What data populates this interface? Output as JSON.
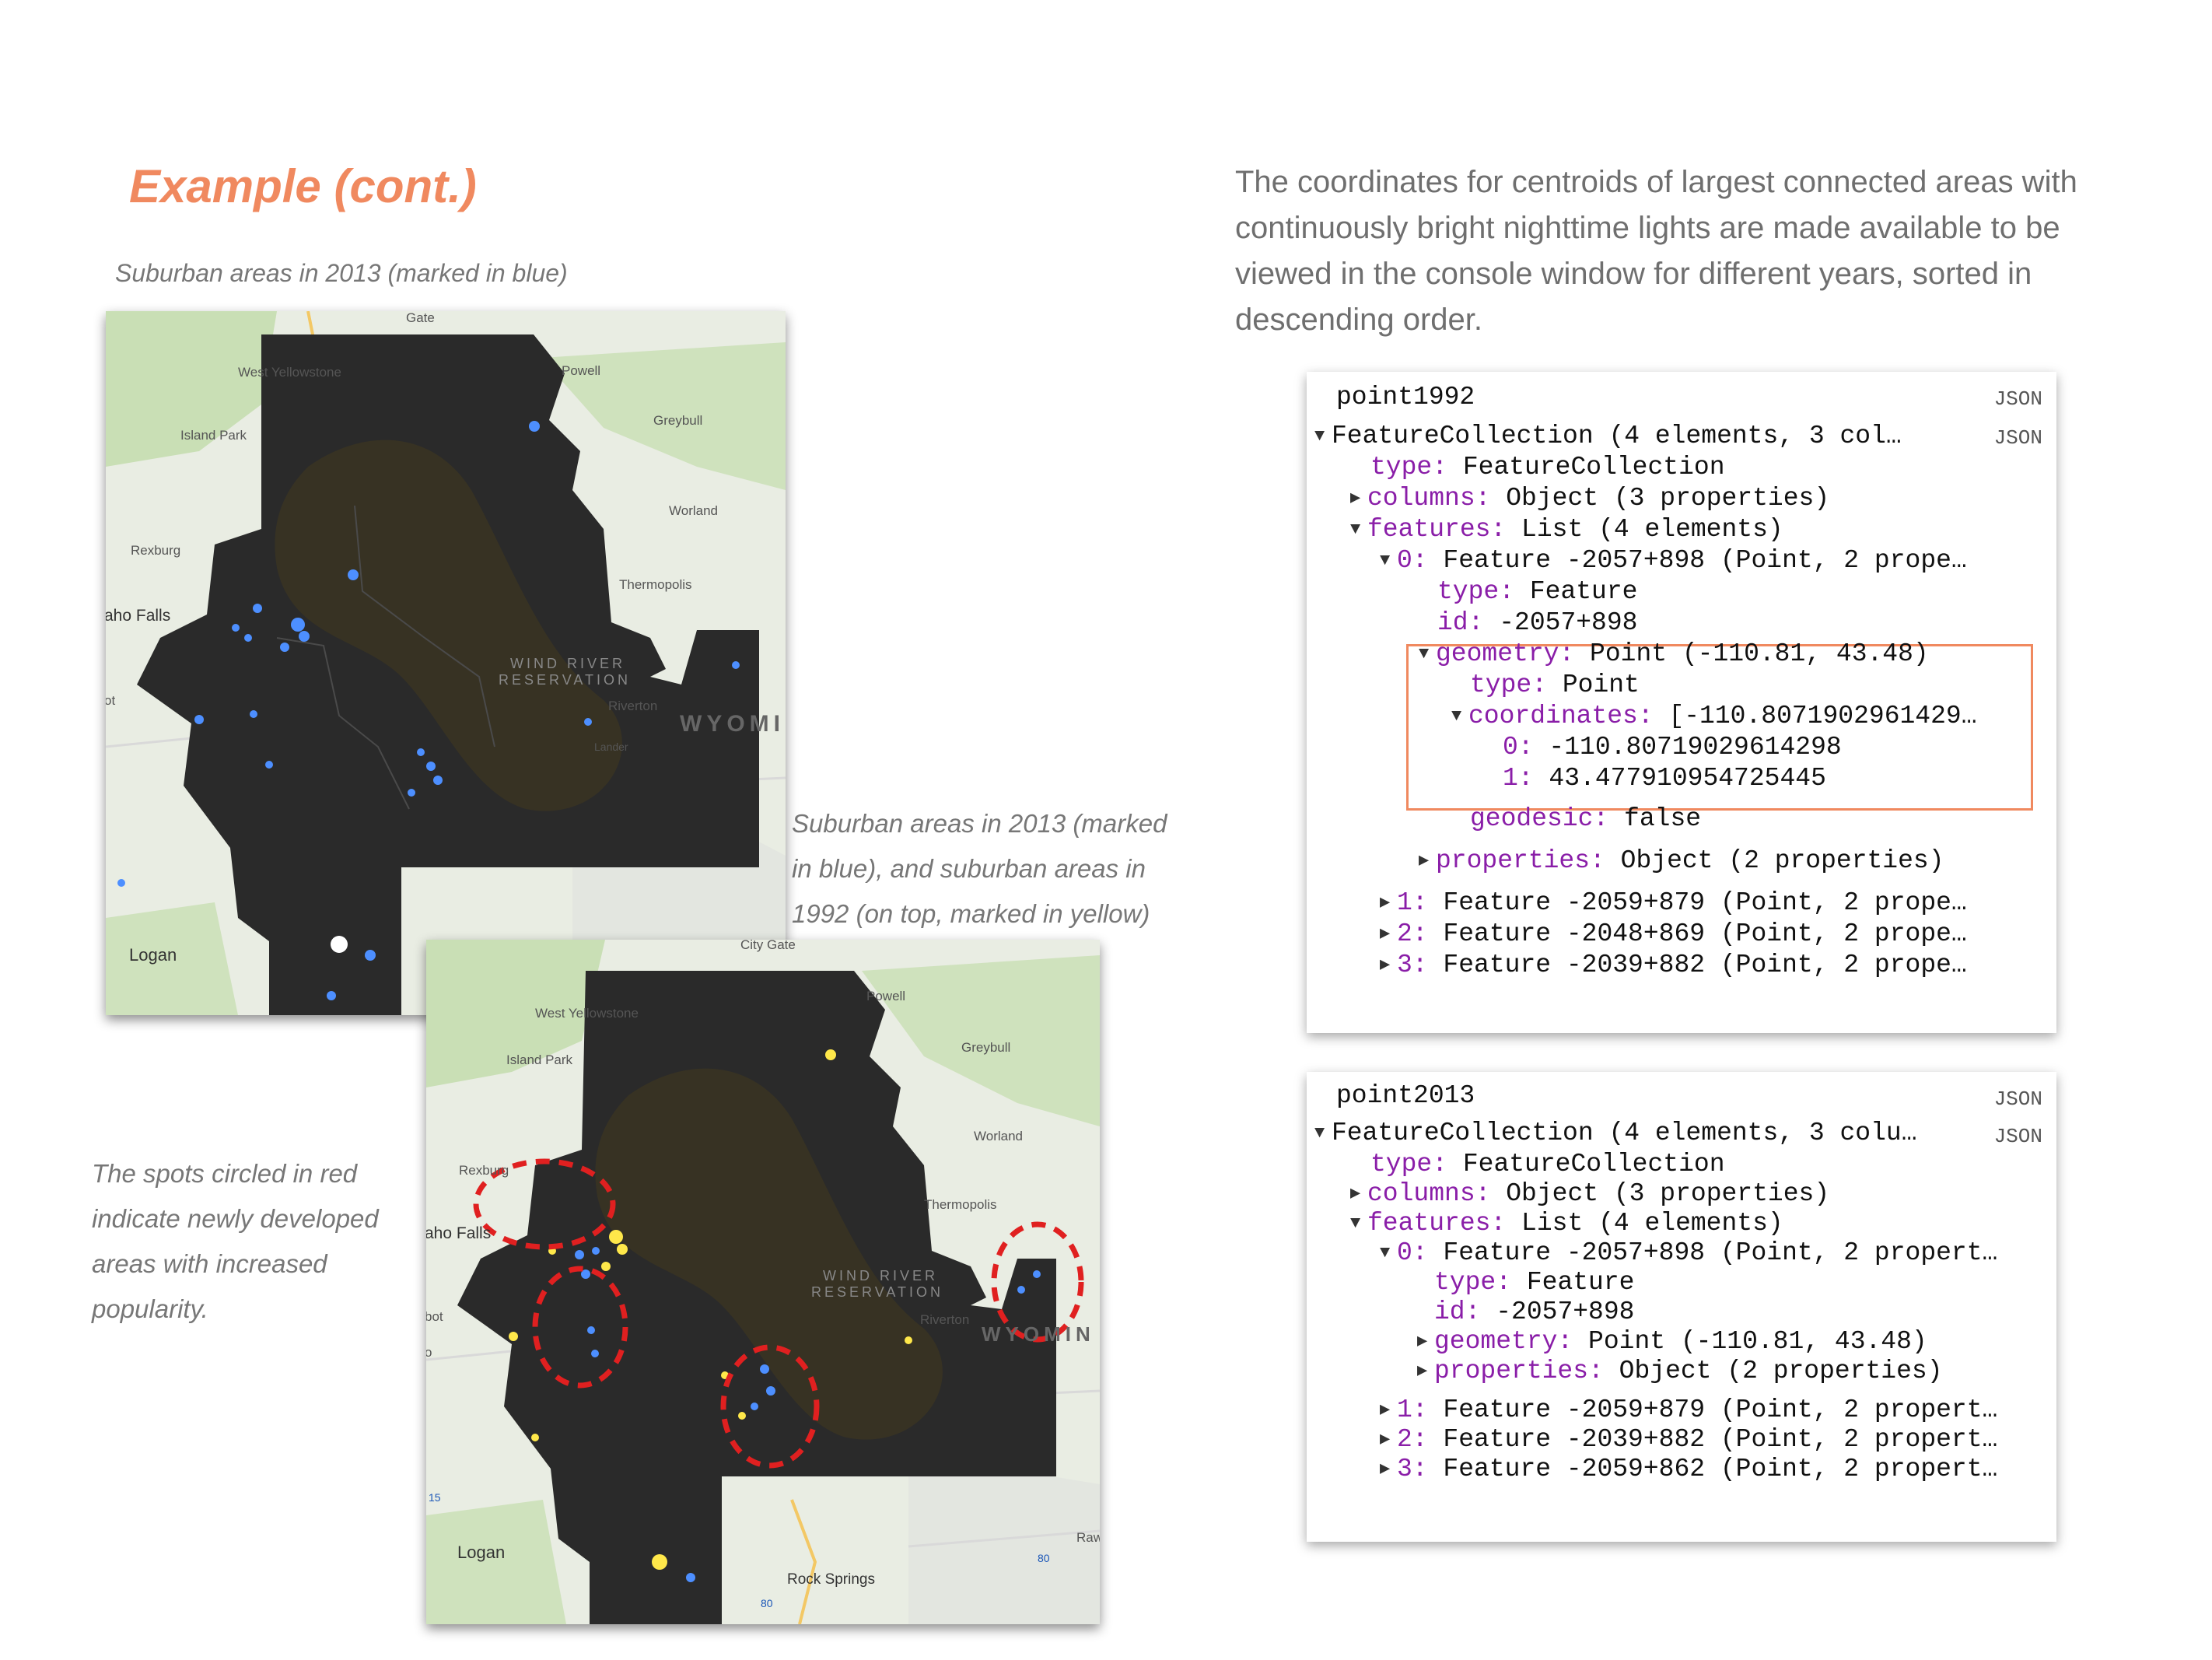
{
  "slide": {
    "title": "Example (cont.)",
    "caption_2013": "Suburban areas in 2013 (marked in blue)",
    "caption_compare_lines": [
      "Suburban areas in 2013 (marked",
      "in blue), and suburban  areas in",
      "1992 (on top, marked in yellow)"
    ],
    "caption_circles_lines": [
      "The spots circled in red",
      "indicate newly developed",
      "areas with increased",
      "popularity."
    ],
    "intro_lines": [
      "The coordinates for centroids of largest connected areas with",
      "continuously bright nighttime lights are made available to be",
      "viewed in the console window for different years, sorted in",
      "descending order."
    ]
  },
  "colors": {
    "title_orange": "#f0895f",
    "json_key_purple": "#8a1ea8",
    "highlight_box": "#f0895f",
    "circle_red": "#e02020",
    "light_blue": "#4d8fff",
    "light_yellow": "#ffe84a"
  },
  "maps": {
    "map_a": {
      "labels": [
        "Gate",
        "West Yellowstone",
        "Island Park",
        "Powell",
        "Greybull",
        "Worland",
        "Rexburg",
        "Thermopolis",
        "aho Falls",
        "WIND RIVER",
        "RESERVATION",
        "Riverton",
        "WYOMI",
        "Lander",
        "ot",
        "Logan"
      ]
    },
    "map_b": {
      "labels": [
        "City Gate",
        "Powell",
        "West Yellowstone",
        "Island Park",
        "Greybull",
        "Worland",
        "Rexburg",
        "Thermopolis",
        "aho Falls",
        "WIND RIVER",
        "RESERVATION",
        "Riverton",
        "WYOMIN",
        "bot",
        "o",
        "Logan",
        "Rock Springs",
        "Raw",
        "15",
        "80",
        "80"
      ]
    }
  },
  "console_1992": {
    "name": "point1992",
    "json_tag": "JSON",
    "collection": "FeatureCollection (4 elements, 3 col…",
    "collection_tag": "JSON",
    "type_key": "type:",
    "type_val": "FeatureCollection",
    "columns_key": "columns:",
    "columns_val": "Object (3 properties)",
    "features_key": "features:",
    "features_val": "List (4 elements)",
    "f0_key": "0:",
    "f0_val": "Feature -2057+898 (Point, 2 prope…",
    "f0_type_key": "type:",
    "f0_type_val": "Feature",
    "f0_id_key": "id:",
    "f0_id_val": "-2057+898",
    "geom_key": "geometry:",
    "geom_val": "Point (-110.81, 43.48)",
    "gtype_key": "type:",
    "gtype_val": "Point",
    "coords_key": "coordinates:",
    "coords_val": "[-110.8071902961429…",
    "c0_key": "0:",
    "c0_val": "-110.80719029614298",
    "c1_key": "1:",
    "c1_val": "43.477910954725445",
    "geodesic_key": "geodesic:",
    "geodesic_val": "false",
    "props_key": "properties:",
    "props_val": "Object (2 properties)",
    "f1_key": "1:",
    "f1_val": "Feature -2059+879 (Point, 2 prope…",
    "f2_key": "2:",
    "f2_val": "Feature -2048+869 (Point, 2 prope…",
    "f3_key": "3:",
    "f3_val": "Feature -2039+882 (Point, 2 prope…"
  },
  "console_2013": {
    "name": "point2013",
    "json_tag": "JSON",
    "collection": "FeatureCollection (4 elements, 3 colu…",
    "collection_tag": "JSON",
    "type_key": "type:",
    "type_val": "FeatureCollection",
    "columns_key": "columns:",
    "columns_val": "Object (3 properties)",
    "features_key": "features:",
    "features_val": "List (4 elements)",
    "f0_key": "0:",
    "f0_val": "Feature -2057+898 (Point, 2 propert…",
    "f0_type_key": "type:",
    "f0_type_val": "Feature",
    "f0_id_key": "id:",
    "f0_id_val": "-2057+898",
    "geom_key": "geometry:",
    "geom_val": "Point (-110.81, 43.48)",
    "props_key": "properties:",
    "props_val": "Object (2 properties)",
    "f1_key": "1:",
    "f1_val": "Feature -2059+879 (Point, 2 propert…",
    "f2_key": "2:",
    "f2_val": "Feature -2039+882 (Point, 2 propert…",
    "f3_key": "3:",
    "f3_val": "Feature -2059+862 (Point, 2 propert…"
  }
}
